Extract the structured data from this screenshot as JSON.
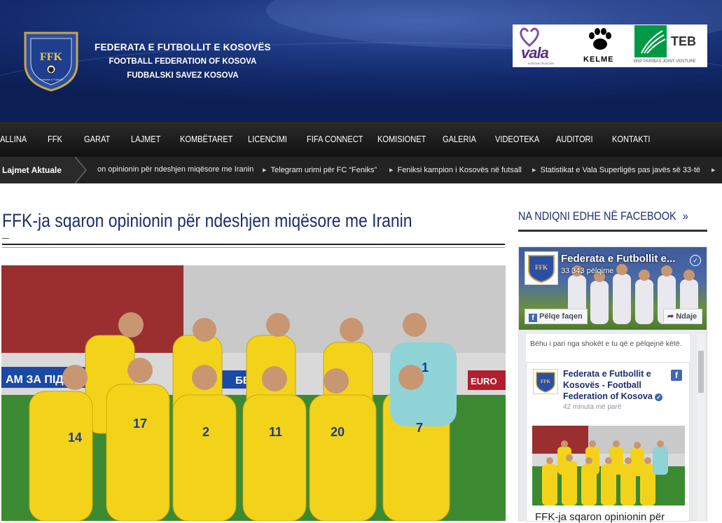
{
  "header": {
    "org_name_sq": "FEDERATA E FUTBOLLIT E KOSOVËS",
    "org_name_en": "FOOTBALL FEDERATION OF KOSOVA",
    "org_name_sr": "FUDBALSKI SAVEZ KOSOVA",
    "badge_text": "FFK",
    "badge_ring_text": "Federata e Futbollit",
    "sponsors": [
      {
        "name": "vala",
        "label": "vala",
        "sub": "KOSOVA TELECOM"
      },
      {
        "name": "kelme",
        "label": "KELME"
      },
      {
        "name": "teb",
        "label": "TEB",
        "sub": "BNP PARIBAS JOINT VENTURE"
      }
    ]
  },
  "nav": {
    "items": [
      "ALLINA",
      "FFK",
      "GARAT",
      "LAJMET",
      "KOMBËTARET",
      "LICENCIMI",
      "FIFA CONNECT",
      "KOMISIONET",
      "GALERIA",
      "VIDEOTEKA",
      "AUDITORI",
      "KONTAKTI"
    ]
  },
  "ticker": {
    "label": "Lajmet Aktuale",
    "items": [
      "on opinionin për ndeshjen miqësore me Iranin",
      "Telegram urimi për FC “Feniks”",
      "Feniksi kampion i Kosovës në futsall",
      "Statistikat e Vala Superligës pas javës së 33-të"
    ]
  },
  "article": {
    "title": "FFK-ja sqaron opinionin për ndeshjen miqësore me Iranin",
    "photo_banner_left": "АМ ЗА ПІДТ",
    "photo_banner_mid": "ББЫ",
    "photo_banner_right": "EURO",
    "shirt_numbers": [
      "14",
      "17",
      "2",
      "11",
      "20",
      "7",
      "1"
    ]
  },
  "sidebar": {
    "fb_heading": "NA NDIQNI EDHE NË FACEBOOK",
    "fb_page_name": "Federata e Futbollit e...",
    "fb_likes": "33 343 pëlqime",
    "fb_like_button": "Pëlqe faqen",
    "fb_share_button": "Ndaje",
    "fb_friends_text": "Bëhu i pari nga shokët e tu që e pëlqejnë këtë.",
    "post_author": "Federata e Futbollit e Kosovës - Football Federation of Kosova",
    "post_time": "42 minuta më parë",
    "post_caption": "FFK-ja sqaron opinionin për"
  },
  "colors": {
    "header_blue": "#12296a",
    "title_navy": "#1c2e6b",
    "nav_black": "#111111",
    "fb_blue": "#4267b2"
  }
}
